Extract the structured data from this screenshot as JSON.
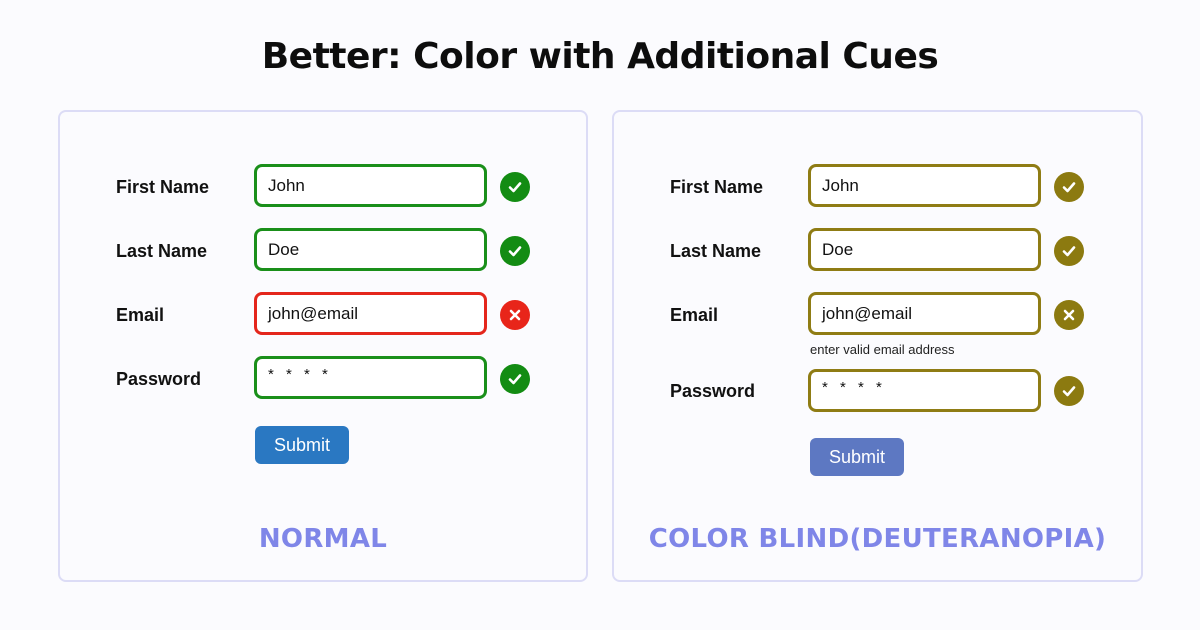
{
  "title": "Better: Color with Additional Cues",
  "colors": {
    "normal_valid": "#138c13",
    "normal_invalid": "#e8251a",
    "colorblind_mark": "#8c7a10",
    "normal_submit": "#2a78c2",
    "colorblind_submit": "#5d78c2",
    "caption": "#7f86e8",
    "panel_border": "#dcdcf6"
  },
  "normal": {
    "caption": "NORMAL",
    "fields": [
      {
        "label": "First Name",
        "value": "John",
        "state": "valid",
        "icon": "check-icon"
      },
      {
        "label": "Last Name",
        "value": "Doe",
        "state": "valid",
        "icon": "check-icon"
      },
      {
        "label": "Email",
        "value": "john@email",
        "state": "invalid",
        "icon": "x-icon"
      },
      {
        "label": "Password",
        "value": "* * * *",
        "state": "valid",
        "icon": "check-icon"
      }
    ],
    "submit_label": "Submit"
  },
  "colorblind": {
    "caption": "COLOR BLIND(DEUTERANOPIA)",
    "fields": [
      {
        "label": "First Name",
        "value": "John",
        "state": "valid",
        "icon": "check-icon"
      },
      {
        "label": "Last Name",
        "value": "Doe",
        "state": "valid",
        "icon": "check-icon"
      },
      {
        "label": "Email",
        "value": "john@email",
        "state": "invalid",
        "icon": "x-icon",
        "hint": "enter valid email address"
      },
      {
        "label": "Password",
        "value": "* * * *",
        "state": "valid",
        "icon": "check-icon"
      }
    ],
    "submit_label": "Submit"
  }
}
